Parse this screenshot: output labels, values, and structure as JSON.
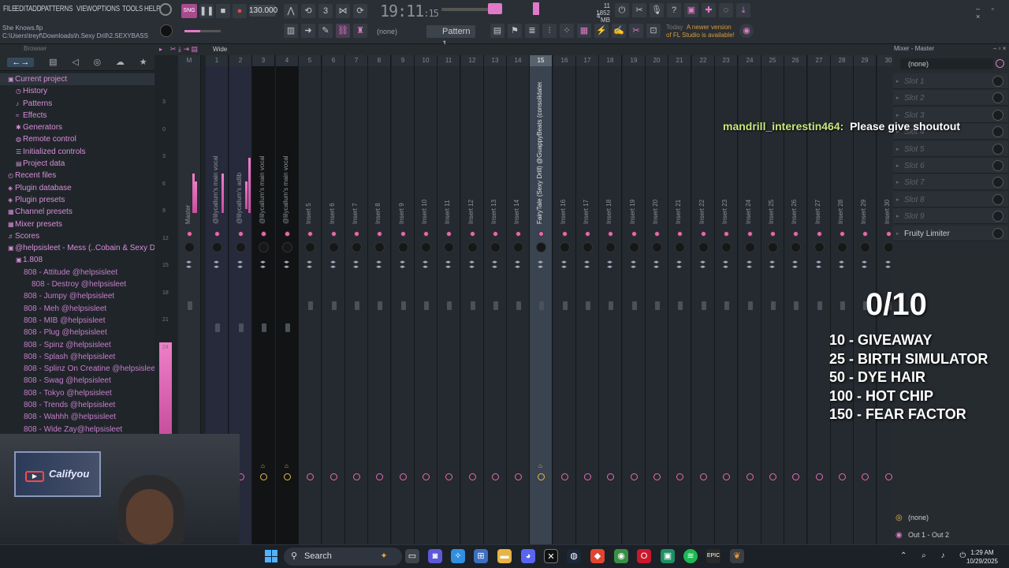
{
  "menu": {
    "items": [
      "FILE",
      "EDIT",
      "ADD",
      "PATTERNS",
      "VIEW",
      "OPTIONS",
      "TOOLS",
      "HELP"
    ]
  },
  "transport": {
    "tempo": "130.000",
    "clock_main": "19:11",
    "clock_sub": "15",
    "memory": "1852 MB",
    "cpu_count": "11",
    "poly": "4"
  },
  "pattern": {
    "selector": "Pattern 1",
    "name": "(none)"
  },
  "notice": {
    "today": "Today",
    "text": "A newer version of FL Studio is available!"
  },
  "project": {
    "name": "She Knows.flp",
    "path": "C:\\Users\\treyf\\Downloads\\h.Sexy Drill\\2.SEXYBASS"
  },
  "browser": {
    "title": "Browser",
    "tabs": [
      "←→",
      "▤",
      "◁",
      "◎",
      "☁",
      "★"
    ],
    "items": [
      {
        "label": "Current project",
        "icon": "folder-icon",
        "indent": 0,
        "sel": true
      },
      {
        "label": "History",
        "icon": "history-icon",
        "indent": 1
      },
      {
        "label": "Patterns",
        "icon": "note-icon",
        "indent": 1
      },
      {
        "label": "Effects",
        "icon": "fx-icon",
        "indent": 1
      },
      {
        "label": "Generators",
        "icon": "generator-icon",
        "indent": 1
      },
      {
        "label": "Remote control",
        "icon": "remote-icon",
        "indent": 1
      },
      {
        "label": "Initialized controls",
        "icon": "init-icon",
        "indent": 1
      },
      {
        "label": "Project data",
        "icon": "data-icon",
        "indent": 1
      },
      {
        "label": "Recent files",
        "icon": "clock-icon",
        "indent": 0
      },
      {
        "label": "Plugin database",
        "icon": "plugin-db-icon",
        "indent": 0
      },
      {
        "label": "Plugin presets",
        "icon": "plugin-icon",
        "indent": 0
      },
      {
        "label": "Channel presets",
        "icon": "channel-icon",
        "indent": 0
      },
      {
        "label": "Mixer presets",
        "icon": "mixer-icon",
        "indent": 0
      },
      {
        "label": "Scores",
        "icon": "score-icon",
        "indent": 0
      },
      {
        "label": "@helpsisleet - Mess (..Cobain & Sexy Drill)",
        "icon": "folder-icon",
        "indent": 0
      },
      {
        "label": "1.808",
        "icon": "folder-icon",
        "indent": 1
      },
      {
        "label": "808 - Attitude @helpsisleet",
        "icon": "",
        "indent": 2,
        "file": true
      },
      {
        "label": "808 - Destroy @helpsisleet",
        "icon": "",
        "indent": 3,
        "file": true
      },
      {
        "label": "808 - Jumpy @helpsisleet",
        "icon": "",
        "indent": 2,
        "file": true
      },
      {
        "label": "808 - Meh @helpsisleet",
        "icon": "",
        "indent": 2,
        "file": true
      },
      {
        "label": "808 - MIB @helpsisleet",
        "icon": "",
        "indent": 2,
        "file": true
      },
      {
        "label": "808 - Plug @helpsisleet",
        "icon": "",
        "indent": 2,
        "file": true
      },
      {
        "label": "808 - Spinz @helpsisleet",
        "icon": "",
        "indent": 2,
        "file": true
      },
      {
        "label": "808 - Splash @helpsisleet",
        "icon": "",
        "indent": 2,
        "file": true
      },
      {
        "label": "808 - Splinz On Creatine @helpsisleet",
        "icon": "",
        "indent": 2,
        "file": true
      },
      {
        "label": "808 - Swag @helpsisleet",
        "icon": "",
        "indent": 2,
        "file": true
      },
      {
        "label": "808 - Tokyo @helpsisleet",
        "icon": "",
        "indent": 2,
        "file": true
      },
      {
        "label": "808 - Trends @helpsisleet",
        "icon": "",
        "indent": 2,
        "file": true
      },
      {
        "label": "808 - Wahhh @helpsisleet",
        "icon": "",
        "indent": 2,
        "file": true
      },
      {
        "label": "808 - Wide Zay@helpsisleet",
        "icon": "",
        "indent": 2,
        "file": true
      }
    ]
  },
  "mixer": {
    "toolbar_label": "Wide",
    "tracks": [
      {
        "num": "M",
        "name": "Master",
        "type": "m"
      },
      {
        "num": "1",
        "name": "@lilycallum's main vocal",
        "type": "h"
      },
      {
        "num": "2",
        "name": "@lilycallum's adlib",
        "type": "h"
      },
      {
        "num": "3",
        "name": "@lilycallum's main vocal",
        "type": "d"
      },
      {
        "num": "4",
        "name": "@lilycallum's main vocal",
        "type": "d"
      },
      {
        "num": "5",
        "name": "Insert 5"
      },
      {
        "num": "6",
        "name": "Insert 6"
      },
      {
        "num": "7",
        "name": "Insert 7"
      },
      {
        "num": "8",
        "name": "Insert 8"
      },
      {
        "num": "9",
        "name": "Insert 9"
      },
      {
        "num": "10",
        "name": "Insert 10"
      },
      {
        "num": "11",
        "name": "Insert 11"
      },
      {
        "num": "12",
        "name": "Insert 12"
      },
      {
        "num": "13",
        "name": "Insert 13"
      },
      {
        "num": "14",
        "name": "Insert 14"
      },
      {
        "num": "15",
        "name": "FairyTale (Sexy Drill) @GuappyBeats (consolidated)",
        "type": "sel"
      },
      {
        "num": "16",
        "name": "Insert 16"
      },
      {
        "num": "17",
        "name": "Insert 17"
      },
      {
        "num": "18",
        "name": "Insert 18"
      },
      {
        "num": "19",
        "name": "Insert 19"
      },
      {
        "num": "20",
        "name": "Insert 20"
      },
      {
        "num": "21",
        "name": "Insert 21"
      },
      {
        "num": "22",
        "name": "Insert 22"
      },
      {
        "num": "23",
        "name": "Insert 23"
      },
      {
        "num": "24",
        "name": "Insert 24"
      },
      {
        "num": "25",
        "name": "Insert 25"
      },
      {
        "num": "26",
        "name": "Insert 26"
      },
      {
        "num": "27",
        "name": "Insert 27"
      },
      {
        "num": "28",
        "name": "Insert 28"
      },
      {
        "num": "29",
        "name": "Insert 29"
      },
      {
        "num": "30",
        "name": "Insert 30"
      }
    ],
    "scale": [
      "3",
      "0",
      "3",
      "6",
      "9",
      "12",
      "15",
      "18",
      "21",
      "24"
    ]
  },
  "mixer_panel": {
    "title": "Mixer - Master",
    "input": "(none)",
    "slots": [
      "Slot 1",
      "Slot 2",
      "Slot 3",
      "Slot 4",
      "Slot 5",
      "Slot 6",
      "Slot 7",
      "Slot 8",
      "Slot 9",
      "Fruity Limiter"
    ],
    "bottom_input": "(none)",
    "output": "Out 1 - Out 2"
  },
  "overlay": {
    "chat_user": "mandrill_interestin464:",
    "chat_msg": "Please give shoutout",
    "counter": "0/10",
    "goals": [
      "10 - GIVEAWAY",
      "25 - BIRTH SIMULATOR",
      "50 - DYE HAIR",
      "100 - HOT CHIP",
      "150 - FEAR FACTOR"
    ]
  },
  "webcam": {
    "poster_text": "Califyou"
  },
  "taskbar": {
    "search": "Search",
    "time": "1:29 AM",
    "date": "10/29/2025"
  }
}
